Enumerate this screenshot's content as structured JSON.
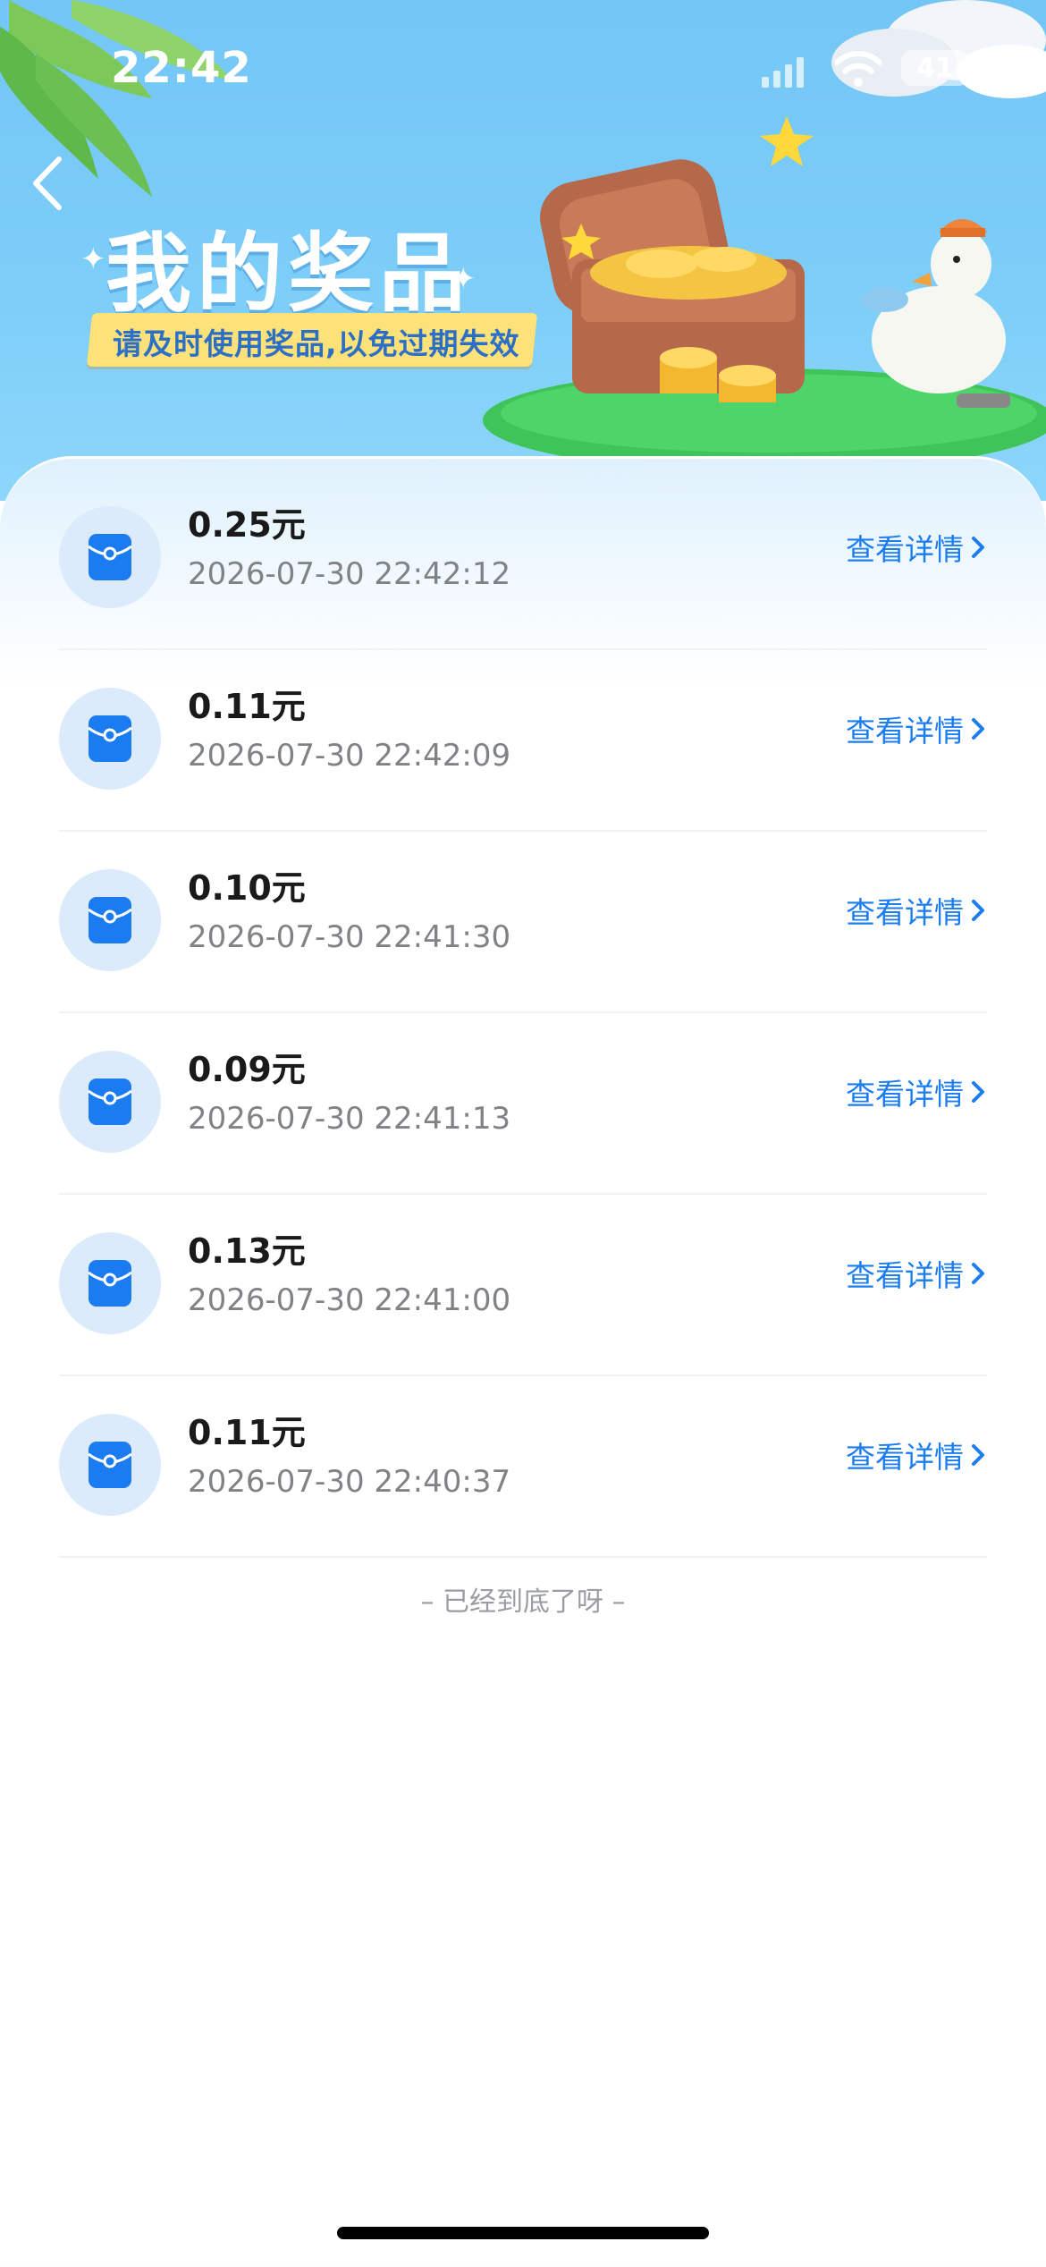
{
  "status_bar": {
    "time": "22:42",
    "battery": "41"
  },
  "header": {
    "title": "我的奖品",
    "subtitle": "请及时使用奖品,以免过期失效"
  },
  "colors": {
    "accent": "#1c7df0",
    "header_bg": "#74c6f6",
    "banner": "#fde27a"
  },
  "prizes": [
    {
      "amount": "0.25元",
      "time": "2026-07-30 22:42:12",
      "link": "查看详情"
    },
    {
      "amount": "0.11元",
      "time": "2026-07-30 22:42:09",
      "link": "查看详情"
    },
    {
      "amount": "0.10元",
      "time": "2026-07-30 22:41:30",
      "link": "查看详情"
    },
    {
      "amount": "0.09元",
      "time": "2026-07-30 22:41:13",
      "link": "查看详情"
    },
    {
      "amount": "0.13元",
      "time": "2026-07-30 22:41:00",
      "link": "查看详情"
    },
    {
      "amount": "0.11元",
      "time": "2026-07-30 22:40:37",
      "link": "查看详情"
    }
  ],
  "footer": {
    "end_note": "– 已经到底了呀 –"
  },
  "icons": {
    "back": "chevron-left-icon",
    "prize": "red-packet-icon",
    "detail": "chevron-right-icon"
  }
}
